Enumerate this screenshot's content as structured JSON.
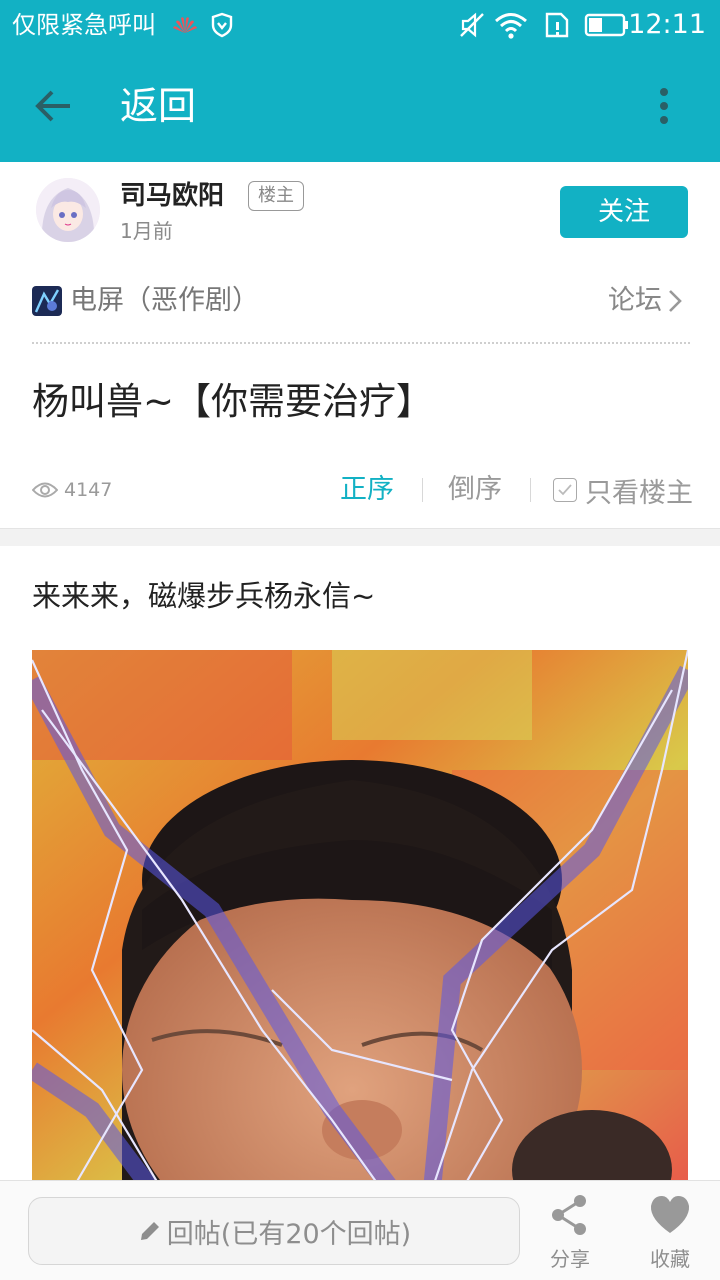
{
  "status_bar": {
    "carrier": "仅限紧急呼叫",
    "time": "12:11"
  },
  "app_bar": {
    "back_label": "返回"
  },
  "author": {
    "name": "司马欧阳",
    "badge": "楼主",
    "time": "1月前",
    "follow_label": "关注"
  },
  "forum": {
    "name": "电屏（恶作剧）",
    "link_label": "论坛"
  },
  "post": {
    "title": "杨叫兽~【你需要治疗】",
    "views": "4147",
    "sort_asc": "正序",
    "sort_desc": "倒序",
    "only_owner": "只看楼主",
    "text": "来来来，磁爆步兵杨永信~"
  },
  "bottom_bar": {
    "reply_label": "回帖(已有20个回帖)",
    "share_label": "分享",
    "favorite_label": "收藏"
  },
  "colors": {
    "accent": "#12b1c4"
  }
}
